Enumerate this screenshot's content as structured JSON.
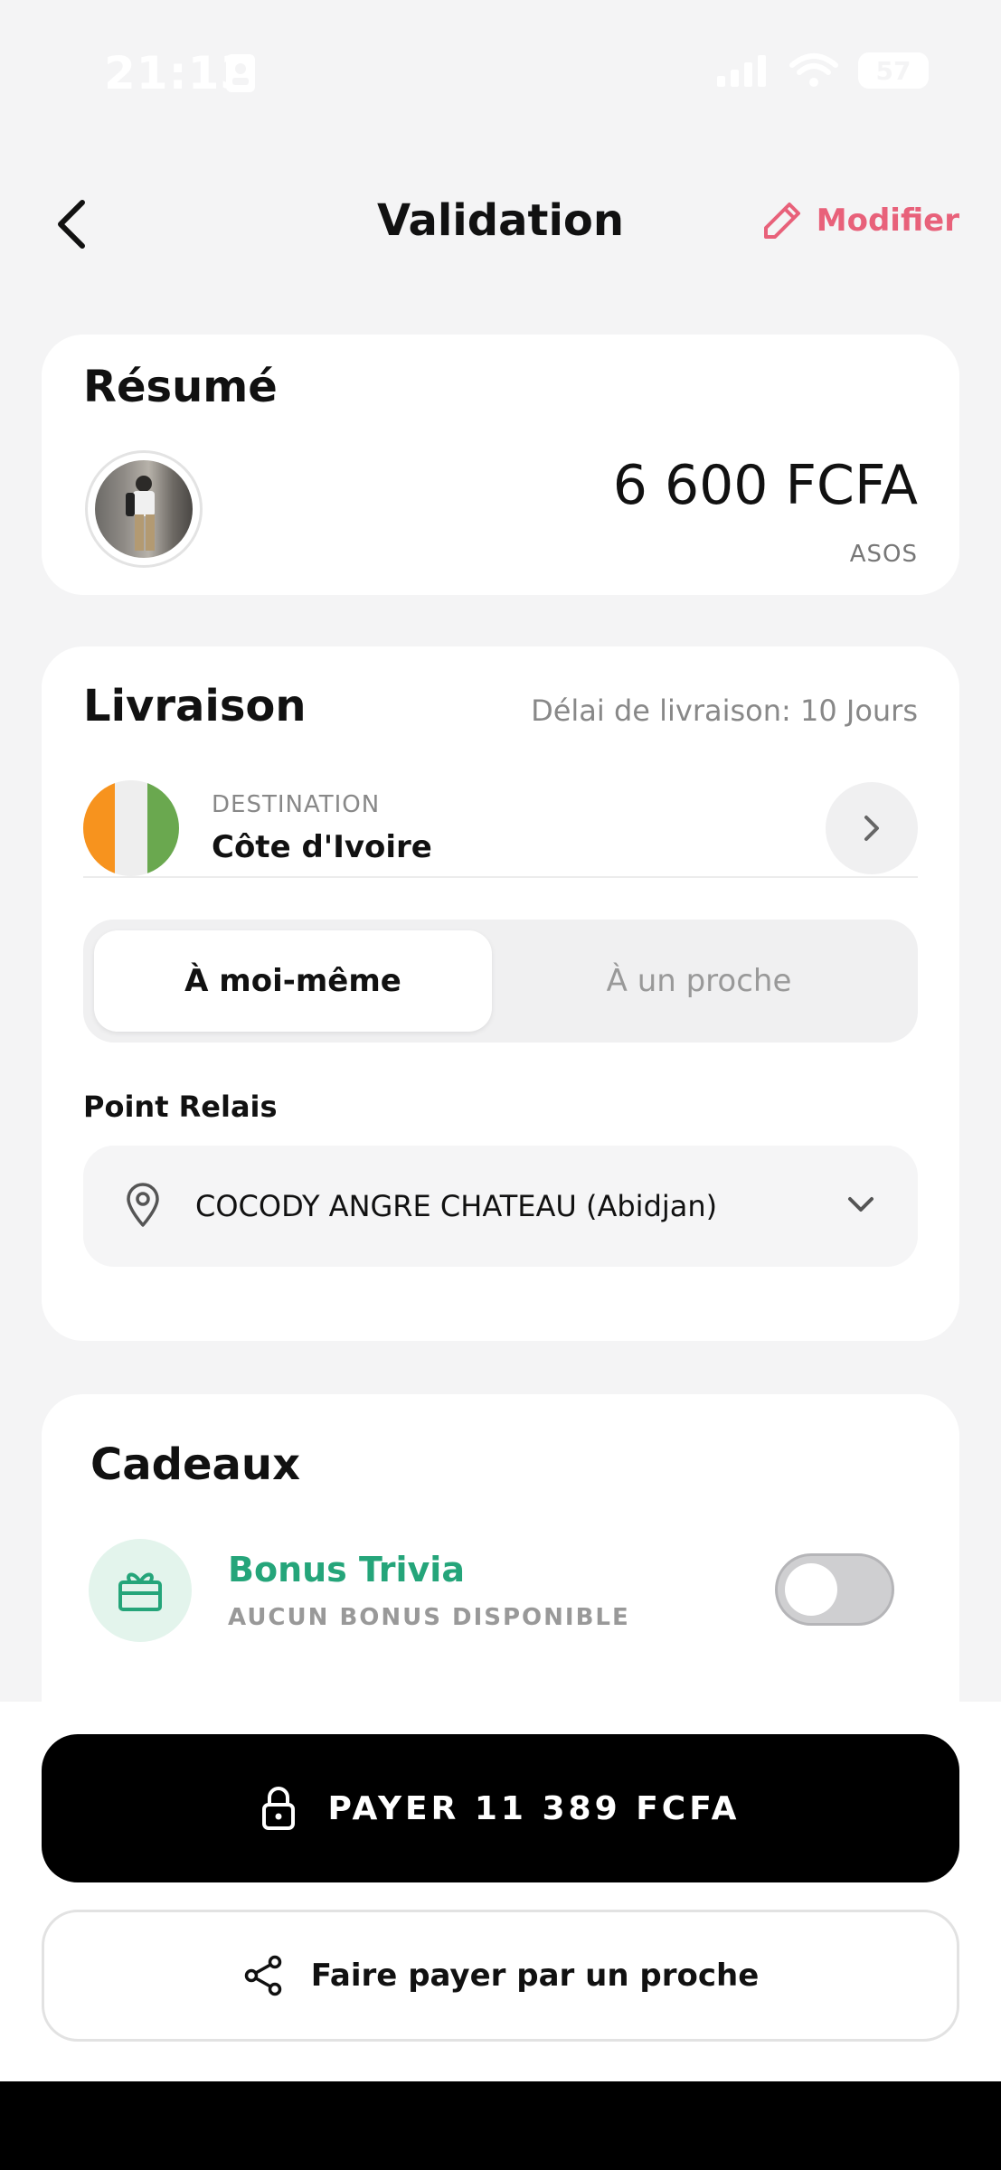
{
  "status_bar": {
    "time": "21:13",
    "battery": "57"
  },
  "header": {
    "title": "Validation",
    "edit_label": "Modifier"
  },
  "summary": {
    "title": "Résumé",
    "amount": "6 600 FCFA",
    "merchant": "ASOS"
  },
  "delivery": {
    "title": "Livraison",
    "delay": "Délai de livraison: 10 Jours",
    "destination_label": "DESTINATION",
    "destination_value": "Côte d'Ivoire",
    "flag_colors": [
      "#f7931e",
      "#eeeeee",
      "#6aa84f"
    ],
    "segments": [
      {
        "label": "À moi-même",
        "selected": true
      },
      {
        "label": "À un proche",
        "selected": false
      }
    ],
    "relay_label": "Point Relais",
    "relay_value": "COCODY ANGRE CHATEAU (Abidjan)"
  },
  "gifts": {
    "title": "Cadeaux",
    "bonus_title": "Bonus Trivia",
    "bonus_status": "AUCUN BONUS DISPONIBLE",
    "toggle_on": false
  },
  "actions": {
    "pay_label": "PAYER 11 389 FCFA",
    "share_label": "Faire payer par un proche"
  },
  "colors": {
    "accent": "#e8617a",
    "green": "#25a57a",
    "primary_button": "#000000"
  },
  "icons": [
    "back-arrow-icon",
    "pencil-icon",
    "chevron-right-icon",
    "location-pin-icon",
    "chevron-down-icon",
    "gift-icon",
    "lock-icon",
    "share-icon"
  ]
}
